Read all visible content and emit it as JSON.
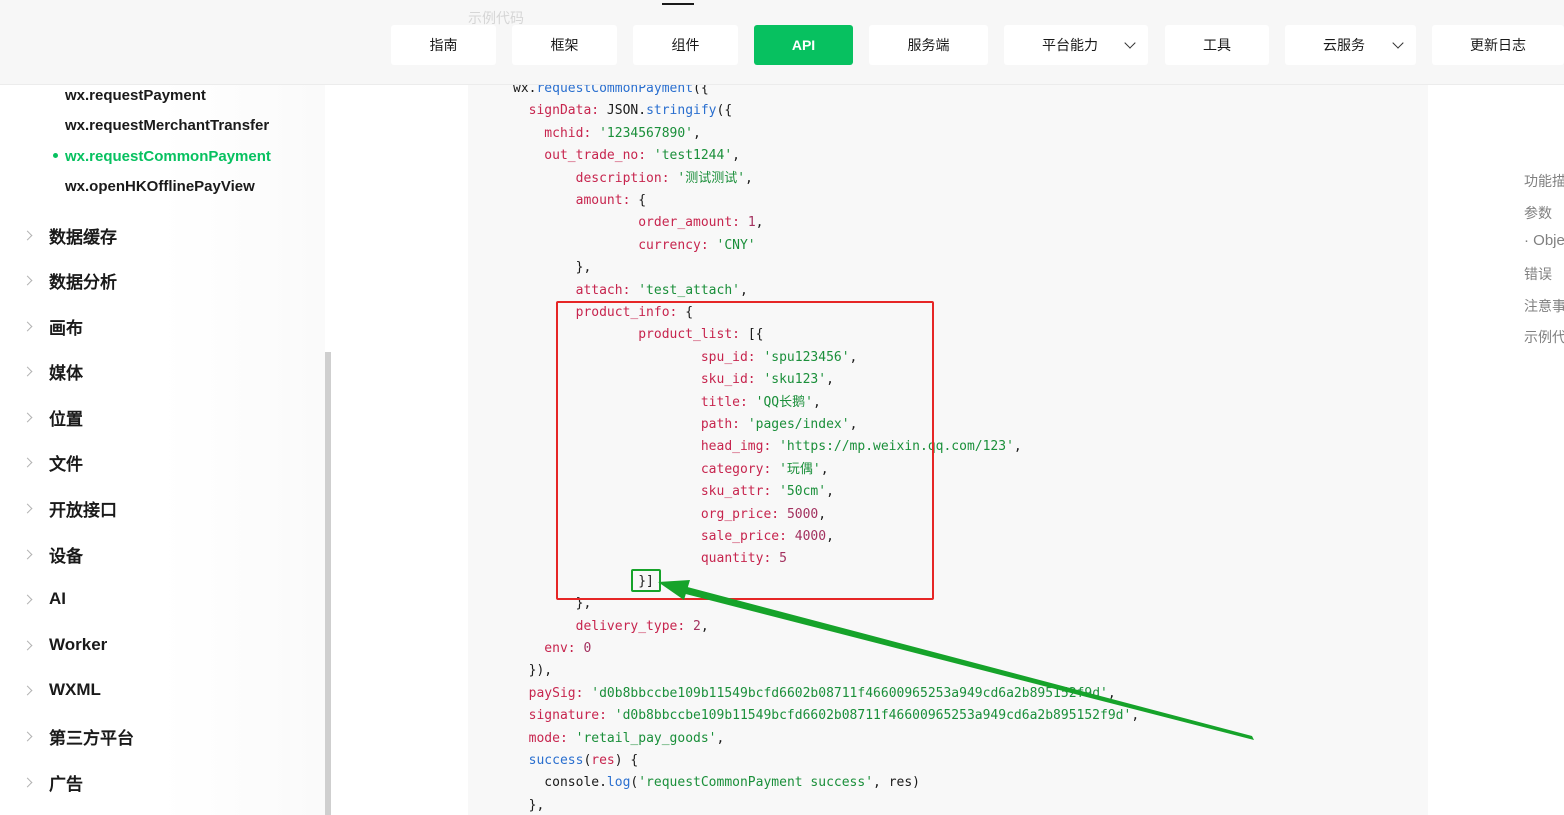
{
  "header": {
    "ghost_title": "示例代码",
    "tabs": [
      {
        "label": "指南"
      },
      {
        "label": "框架"
      },
      {
        "label": "组件"
      },
      {
        "label": "API"
      },
      {
        "label": "服务端"
      },
      {
        "label": "平台能力"
      },
      {
        "label": "工具"
      },
      {
        "label": "云服务"
      },
      {
        "label": "更新日志"
      }
    ]
  },
  "sidebar": {
    "sub_items": [
      {
        "label": "wx.requestPayment"
      },
      {
        "label": "wx.requestMerchantTransfer"
      },
      {
        "label": "wx.requestCommonPayment"
      },
      {
        "label": "wx.openHKOfflinePayView"
      }
    ],
    "categories": [
      {
        "label": "数据缓存"
      },
      {
        "label": "数据分析"
      },
      {
        "label": "画布"
      },
      {
        "label": "媒体"
      },
      {
        "label": "位置"
      },
      {
        "label": "文件"
      },
      {
        "label": "开放接口"
      },
      {
        "label": "设备"
      },
      {
        "label": "AI"
      },
      {
        "label": "Worker"
      },
      {
        "label": "WXML"
      },
      {
        "label": "第三方平台"
      },
      {
        "label": "广告"
      }
    ]
  },
  "toc": {
    "items": [
      {
        "label": "功能描"
      },
      {
        "label": "参数"
      },
      {
        "label": "· Obje"
      },
      {
        "label": "错误"
      },
      {
        "label": "注意事"
      },
      {
        "label": "示例代"
      }
    ]
  },
  "code": {
    "lines": [
      [
        {
          "t": "wx.",
          "c": "p"
        },
        {
          "t": "requestCommonPayment",
          "c": "f"
        },
        {
          "t": "({",
          "c": "p"
        }
      ],
      [
        {
          "t": "  signData: ",
          "c": "k"
        },
        {
          "t": "JSON.",
          "c": "p"
        },
        {
          "t": "stringify",
          "c": "f"
        },
        {
          "t": "({",
          "c": "p"
        }
      ],
      [
        {
          "t": "    mchid: ",
          "c": "k"
        },
        {
          "t": "'1234567890'",
          "c": "s"
        },
        {
          "t": ",",
          "c": "p"
        }
      ],
      [
        {
          "t": "    out_trade_no: ",
          "c": "k"
        },
        {
          "t": "'test1244'",
          "c": "s"
        },
        {
          "t": ",",
          "c": "p"
        }
      ],
      [
        {
          "t": "        description: ",
          "c": "k"
        },
        {
          "t": "'测试测试'",
          "c": "s"
        },
        {
          "t": ",",
          "c": "p"
        }
      ],
      [
        {
          "t": "        amount: ",
          "c": "k"
        },
        {
          "t": "{",
          "c": "p"
        }
      ],
      [
        {
          "t": "                order_amount: ",
          "c": "k"
        },
        {
          "t": "1",
          "c": "v"
        },
        {
          "t": ",",
          "c": "p"
        }
      ],
      [
        {
          "t": "                currency: ",
          "c": "k"
        },
        {
          "t": "'CNY'",
          "c": "s"
        }
      ],
      [
        {
          "t": "        },",
          "c": "p"
        }
      ],
      [
        {
          "t": "        attach: ",
          "c": "k"
        },
        {
          "t": "'test_attach'",
          "c": "s"
        },
        {
          "t": ",",
          "c": "p"
        }
      ],
      [
        {
          "t": "        product_info: ",
          "c": "k"
        },
        {
          "t": "{",
          "c": "p"
        }
      ],
      [
        {
          "t": "                product_list: ",
          "c": "k"
        },
        {
          "t": "[{",
          "c": "p"
        }
      ],
      [
        {
          "t": "                        spu_id: ",
          "c": "k"
        },
        {
          "t": "'spu123456'",
          "c": "s"
        },
        {
          "t": ",",
          "c": "p"
        }
      ],
      [
        {
          "t": "                        sku_id: ",
          "c": "k"
        },
        {
          "t": "'sku123'",
          "c": "s"
        },
        {
          "t": ",",
          "c": "p"
        }
      ],
      [
        {
          "t": "                        title: ",
          "c": "k"
        },
        {
          "t": "'QQ长鹅'",
          "c": "s"
        },
        {
          "t": ",",
          "c": "p"
        }
      ],
      [
        {
          "t": "                        path: ",
          "c": "k"
        },
        {
          "t": "'pages/index'",
          "c": "s"
        },
        {
          "t": ",",
          "c": "p"
        }
      ],
      [
        {
          "t": "                        head_img: ",
          "c": "k"
        },
        {
          "t": "'https://mp.weixin.qq.com/123'",
          "c": "s"
        },
        {
          "t": ",",
          "c": "p"
        }
      ],
      [
        {
          "t": "                        category: ",
          "c": "k"
        },
        {
          "t": "'玩偶'",
          "c": "s"
        },
        {
          "t": ",",
          "c": "p"
        }
      ],
      [
        {
          "t": "                        sku_attr: ",
          "c": "k"
        },
        {
          "t": "'50cm'",
          "c": "s"
        },
        {
          "t": ",",
          "c": "p"
        }
      ],
      [
        {
          "t": "                        org_price: ",
          "c": "k"
        },
        {
          "t": "5000",
          "c": "v"
        },
        {
          "t": ",",
          "c": "p"
        }
      ],
      [
        {
          "t": "                        sale_price: ",
          "c": "k"
        },
        {
          "t": "4000",
          "c": "v"
        },
        {
          "t": ",",
          "c": "p"
        }
      ],
      [
        {
          "t": "                        quantity: ",
          "c": "k"
        },
        {
          "t": "5",
          "c": "v"
        }
      ],
      [
        {
          "t": "                }]",
          "c": "p"
        }
      ],
      [
        {
          "t": "        },",
          "c": "p"
        }
      ],
      [
        {
          "t": "        delivery_type: ",
          "c": "k"
        },
        {
          "t": "2",
          "c": "v"
        },
        {
          "t": ",",
          "c": "p"
        }
      ],
      [
        {
          "t": "    env: ",
          "c": "k"
        },
        {
          "t": "0",
          "c": "v"
        }
      ],
      [
        {
          "t": "  }),",
          "c": "p"
        }
      ],
      [
        {
          "t": "  paySig: ",
          "c": "k"
        },
        {
          "t": "'d0b8bbccbe109b11549bcfd6602b08711f46600965253a949cd6a2b895152f9d'",
          "c": "s"
        },
        {
          "t": ",",
          "c": "p"
        }
      ],
      [
        {
          "t": "  signature: ",
          "c": "k"
        },
        {
          "t": "'d0b8bbccbe109b11549bcfd6602b08711f46600965253a949cd6a2b895152f9d'",
          "c": "s"
        },
        {
          "t": ",",
          "c": "p"
        }
      ],
      [
        {
          "t": "  mode: ",
          "c": "k"
        },
        {
          "t": "'retail_pay_goods'",
          "c": "s"
        },
        {
          "t": ",",
          "c": "p"
        }
      ],
      [
        {
          "t": "  ",
          "c": "p"
        },
        {
          "t": "success",
          "c": "f"
        },
        {
          "t": "(",
          "c": "p"
        },
        {
          "t": "res",
          "c": "k"
        },
        {
          "t": ") {",
          "c": "p"
        }
      ],
      [
        {
          "t": "    console.",
          "c": "p"
        },
        {
          "t": "log",
          "c": "f"
        },
        {
          "t": "(",
          "c": "p"
        },
        {
          "t": "'requestCommonPayment success'",
          "c": "s"
        },
        {
          "t": ", res)",
          "c": "p"
        }
      ],
      [
        {
          "t": "  },",
          "c": "p"
        }
      ]
    ]
  },
  "colors": {
    "brand_green": "#07c160",
    "annotation_red": "#e62626",
    "annotation_green": "#16a32a"
  }
}
